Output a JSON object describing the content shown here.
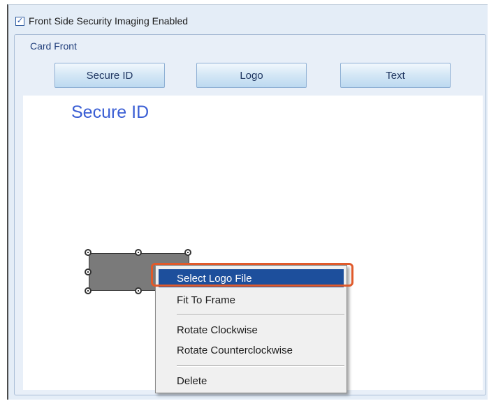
{
  "enable_option": {
    "label": "Front Side Security Imaging Enabled",
    "checked": true
  },
  "card_front": {
    "group_label": "Card Front",
    "buttons": [
      "Secure ID",
      "Logo",
      "Text"
    ]
  },
  "canvas": {
    "secure_id_text": "Secure ID",
    "logo_placeholder": "selected logo placeholder"
  },
  "context_menu": {
    "items": [
      {
        "label": "Select Logo File",
        "selected": true
      },
      {
        "label": "Fit To Frame"
      },
      {
        "label": "Rotate Clockwise"
      },
      {
        "label": "Rotate Counterclockwise"
      },
      {
        "label": "Delete"
      }
    ]
  },
  "colors": {
    "accent_blue": "#1d4f9c",
    "secure_text_blue": "#3a5ed4",
    "highlight_orange": "#e05a2b",
    "panel_bg": "#e4edf7"
  }
}
